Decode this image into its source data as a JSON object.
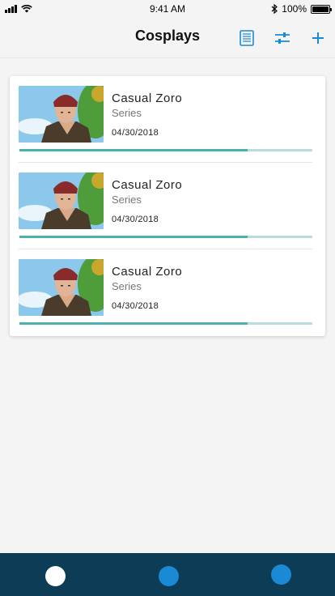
{
  "status_bar": {
    "time": "9:41 AM",
    "battery_text": "100%",
    "signal_icon": "signal-bars-icon",
    "wifi_icon": "wifi-icon",
    "bluetooth_icon": "bluetooth-icon",
    "battery_icon": "battery-icon"
  },
  "header": {
    "title": "Cosplays",
    "actions": [
      {
        "icon": "list-icon"
      },
      {
        "icon": "filter-sliders-icon"
      },
      {
        "icon": "plus-icon"
      }
    ],
    "accent_color": "#1a8ad4"
  },
  "cosplays": [
    {
      "name": "Casual Zoro",
      "type": "Series",
      "date": "04/30/2018",
      "progress": 0.78
    },
    {
      "name": "Casual Zoro",
      "type": "Series",
      "date": "04/30/2018",
      "progress": 0.78
    },
    {
      "name": "Casual Zoro",
      "type": "Series",
      "date": "04/30/2018",
      "progress": 0.78
    }
  ],
  "tab_bar": {
    "background": "#0d3d56",
    "tabs": [
      {
        "name": "tab-1",
        "color": "#ffffff",
        "active": true
      },
      {
        "name": "tab-2",
        "color": "#1a8ad4",
        "active": false
      },
      {
        "name": "tab-3",
        "color": "#1a8ad4",
        "active": false
      }
    ]
  }
}
